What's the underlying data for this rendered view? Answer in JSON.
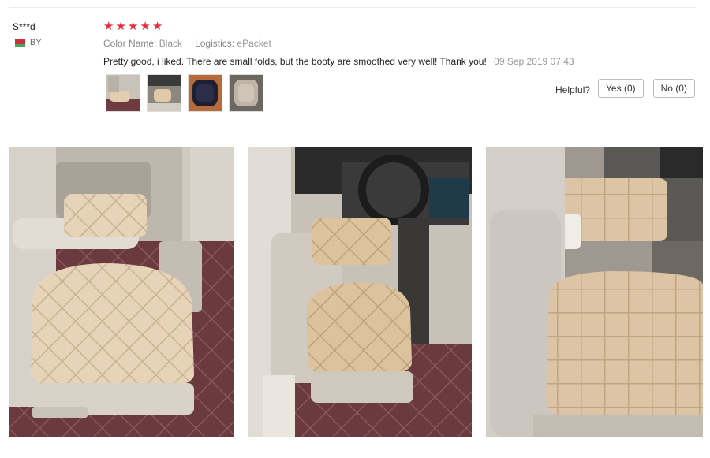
{
  "review": {
    "user": "S***d",
    "country_code": "BY",
    "rating": 5,
    "stars": [
      "★",
      "★",
      "★",
      "★",
      "★"
    ],
    "color_name_label": "Color Name:",
    "color_name_value": "Black",
    "logistics_label": "Logistics:",
    "logistics_value": "ePacket",
    "text": "Pretty good, i liked. There are small folds, but the booty are smoothed very well! Thank you!",
    "date": "09 Sep 2019 07:43",
    "helpful_label": "Helpful?",
    "yes_label": "Yes (0)",
    "no_label": "No (0)"
  },
  "colors": {
    "star": "#e62e3d",
    "cushion": "#e3cdb0",
    "mat": "#6e3b40",
    "seat": "#d6d0c6"
  },
  "thumbnails": [
    "photo-1",
    "photo-2",
    "photo-3",
    "photo-4"
  ]
}
